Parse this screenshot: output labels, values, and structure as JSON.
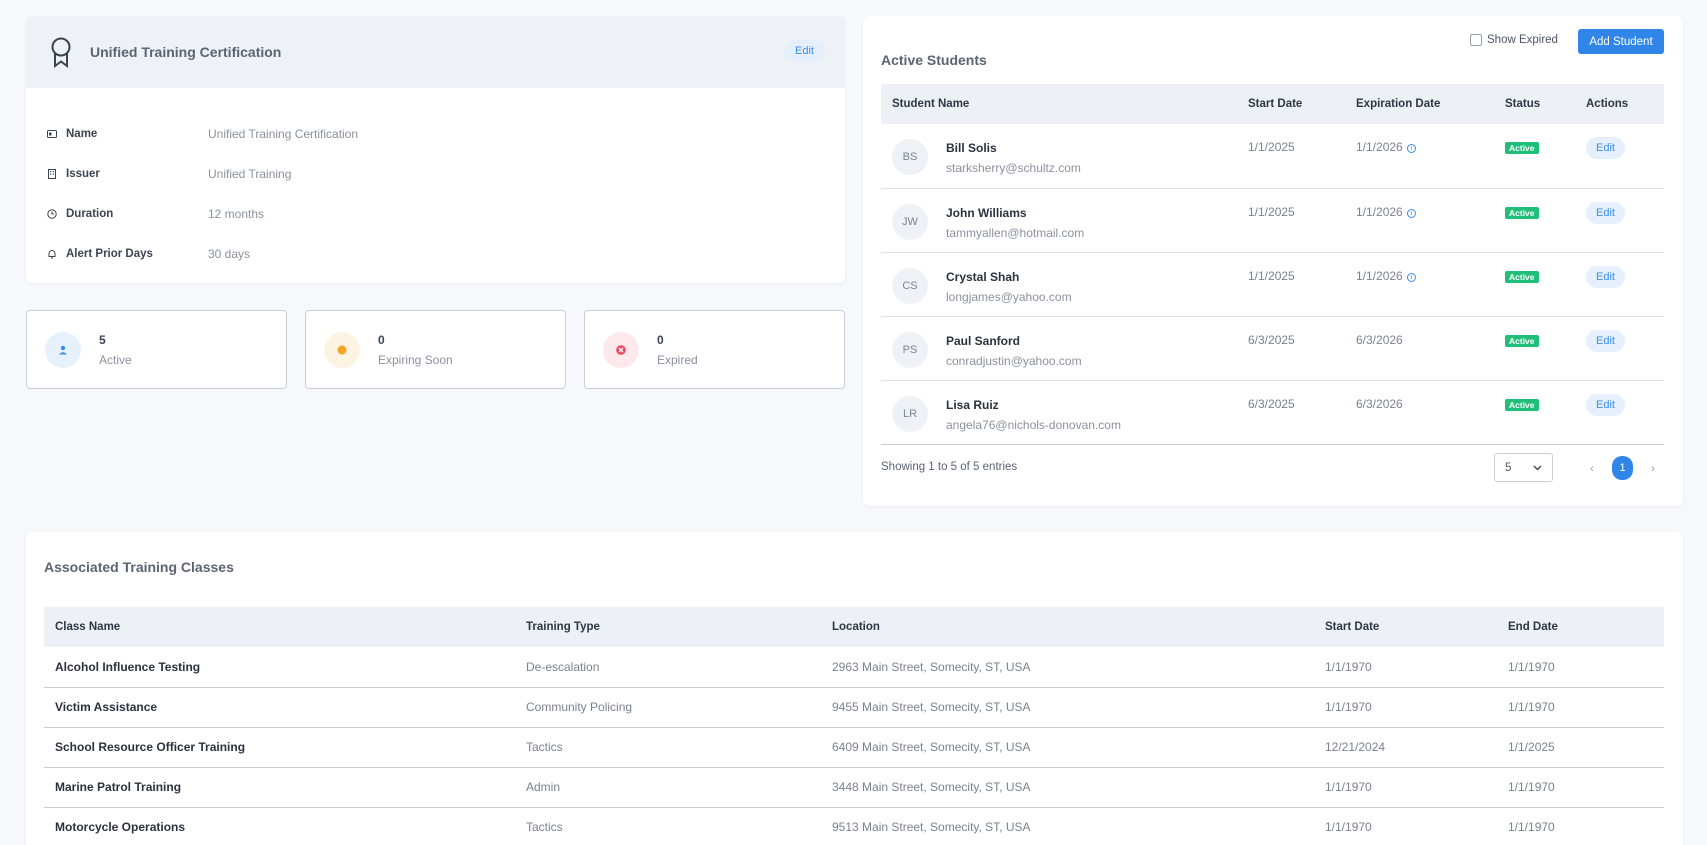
{
  "certification": {
    "title": "Unified Training Certification",
    "edit_label": "Edit",
    "fields": [
      {
        "label": "Name",
        "value": "Unified Training Certification",
        "icon": "id-card-icon"
      },
      {
        "label": "Issuer",
        "value": "Unified Training",
        "icon": "building-icon"
      },
      {
        "label": "Duration",
        "value": "12 months",
        "icon": "clock-icon"
      },
      {
        "label": "Alert Prior Days",
        "value": "30 days",
        "icon": "bell-icon"
      }
    ]
  },
  "stats": [
    {
      "value": "5",
      "label": "Active",
      "icon": "user-icon",
      "color": "#3a8ee6",
      "bg": "#e7f1fc"
    },
    {
      "value": "0",
      "label": "Expiring Soon",
      "icon": "dot-icon",
      "color": "#f6a623",
      "bg": "#fdf3e2"
    },
    {
      "value": "0",
      "label": "Expired",
      "icon": "x-circle-icon",
      "color": "#e8475f",
      "bg": "#fde8eb"
    }
  ],
  "students": {
    "title": "Active Students",
    "show_expired_label": "Show Expired",
    "add_button_label": "Add Student",
    "columns": [
      "Student Name",
      "Start Date",
      "Expiration Date",
      "Status",
      "Actions"
    ],
    "rows": [
      {
        "initials": "BS",
        "name": "Bill Solis",
        "email": "starksherry@schultz.com",
        "start": "1/1/2025",
        "expiration": "1/1/2026",
        "expiring_info": true,
        "status": "Active",
        "action": "Edit"
      },
      {
        "initials": "JW",
        "name": "John Williams",
        "email": "tammyallen@hotmail.com",
        "start": "1/1/2025",
        "expiration": "1/1/2026",
        "expiring_info": true,
        "status": "Active",
        "action": "Edit"
      },
      {
        "initials": "CS",
        "name": "Crystal Shah",
        "email": "longjames@yahoo.com",
        "start": "1/1/2025",
        "expiration": "1/1/2026",
        "expiring_info": true,
        "status": "Active",
        "action": "Edit"
      },
      {
        "initials": "PS",
        "name": "Paul Sanford",
        "email": "conradjustin@yahoo.com",
        "start": "6/3/2025",
        "expiration": "6/3/2026",
        "expiring_info": false,
        "status": "Active",
        "action": "Edit"
      },
      {
        "initials": "LR",
        "name": "Lisa Ruiz",
        "email": "angela76@nichols-donovan.com",
        "start": "6/3/2025",
        "expiration": "6/3/2026",
        "expiring_info": false,
        "status": "Active",
        "action": "Edit"
      }
    ],
    "showing_text": "Showing 1 to 5 of 5 entries",
    "page_size": "5",
    "current_page": "1",
    "prev_label": "‹",
    "next_label": "›"
  },
  "classes": {
    "title": "Associated Training Classes",
    "columns": [
      "Class Name",
      "Training Type",
      "Location",
      "Start Date",
      "End Date"
    ],
    "rows": [
      {
        "name": "Alcohol Influence Testing",
        "type": "De-escalation",
        "location": "2963 Main Street, Somecity, ST, USA",
        "start": "1/1/1970",
        "end": "1/1/1970"
      },
      {
        "name": "Victim Assistance",
        "type": "Community Policing",
        "location": "9455 Main Street, Somecity, ST, USA",
        "start": "1/1/1970",
        "end": "1/1/1970"
      },
      {
        "name": "School Resource Officer Training",
        "type": "Tactics",
        "location": "6409 Main Street, Somecity, ST, USA",
        "start": "12/21/2024",
        "end": "1/1/2025"
      },
      {
        "name": "Marine Patrol Training",
        "type": "Admin",
        "location": "3448 Main Street, Somecity, ST, USA",
        "start": "1/1/1970",
        "end": "1/1/1970"
      },
      {
        "name": "Motorcycle Operations",
        "type": "Tactics",
        "location": "9513 Main Street, Somecity, ST, USA",
        "start": "1/1/1970",
        "end": "1/1/1970"
      }
    ]
  }
}
